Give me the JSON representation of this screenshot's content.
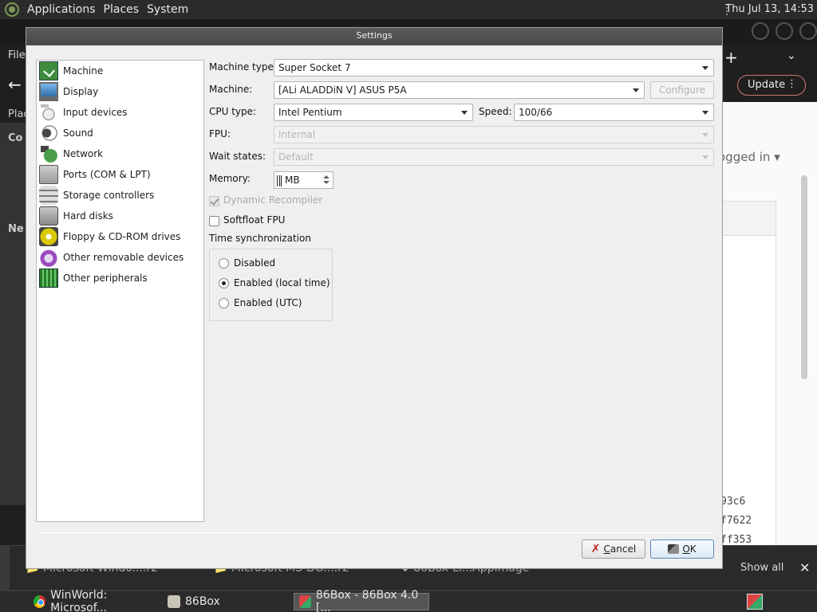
{
  "top_panel": {
    "menus": [
      "Applications",
      "Places",
      "System"
    ],
    "clock": "Thu Jul 13, 14:53"
  },
  "background_browser": {
    "file_menu": "File",
    "update_button": "Update",
    "logged_in_text": "ogged in",
    "left_strip": [
      "Plac",
      "Co",
      "Ne"
    ],
    "hashes": [
      "93c6",
      "f7622",
      "ff353"
    ]
  },
  "downloads_bar": {
    "items": [
      "Microsoft Windo....r2",
      "Microsoft MS-DO....r2",
      "86Box-Li...AppImage"
    ],
    "show_all": "Show all"
  },
  "taskbar": {
    "tasks": [
      "WinWorld: Microsof...",
      "86Box",
      "86Box - 86Box 4.0 [..."
    ]
  },
  "dialog": {
    "title": "Settings",
    "sidebar": [
      {
        "label": "Machine",
        "icon": "machine-icon"
      },
      {
        "label": "Display",
        "icon": "display-icon"
      },
      {
        "label": "Input devices",
        "icon": "input-devices-icon"
      },
      {
        "label": "Sound",
        "icon": "sound-icon"
      },
      {
        "label": "Network",
        "icon": "network-icon"
      },
      {
        "label": "Ports (COM & LPT)",
        "icon": "ports-icon"
      },
      {
        "label": "Storage controllers",
        "icon": "storage-controllers-icon"
      },
      {
        "label": "Hard disks",
        "icon": "hard-disk-icon"
      },
      {
        "label": "Floppy & CD-ROM drives",
        "icon": "floppy-cdrom-icon"
      },
      {
        "label": "Other removable devices",
        "icon": "removable-devices-icon"
      },
      {
        "label": "Other peripherals",
        "icon": "peripherals-icon"
      }
    ],
    "machine_type": {
      "label": "Machine type:",
      "value": "Super Socket 7"
    },
    "machine": {
      "label": "Machine:",
      "value": "[ALi ALADDiN V] ASUS P5A",
      "configure_label": "Configure"
    },
    "cpu_type": {
      "label": "CPU type:",
      "value": "Intel Pentium"
    },
    "speed": {
      "label": "Speed:",
      "value": "100/66"
    },
    "fpu": {
      "label": "FPU:",
      "value": "Internal"
    },
    "wait_states": {
      "label": "Wait states:",
      "value": "Default"
    },
    "memory": {
      "label": "Memory:",
      "value": "MB"
    },
    "dynamic_recompiler": {
      "label": "Dynamic Recompiler",
      "checked": true,
      "enabled": false
    },
    "softfloat_fpu": {
      "label": "Softfloat FPU",
      "checked": false
    },
    "time_sync": {
      "label": "Time synchronization",
      "options": [
        "Disabled",
        "Enabled (local time)",
        "Enabled (UTC)"
      ],
      "selected": "Enabled (local time)"
    },
    "buttons": {
      "cancel": "ancel",
      "cancel_mnemonic": "C",
      "ok": "K",
      "ok_mnemonic": "O"
    }
  }
}
